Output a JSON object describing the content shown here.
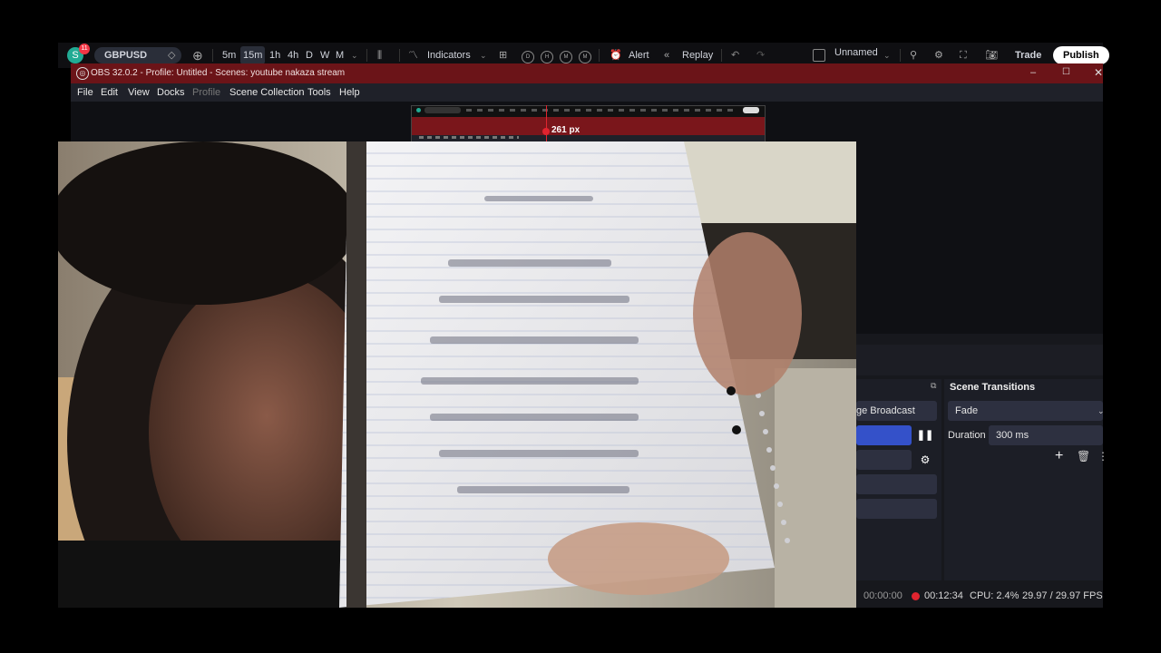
{
  "tradingview": {
    "avatar_letter": "S",
    "notification_count": "11",
    "symbol": "GBPUSD",
    "timeframes": [
      "5m",
      "15m",
      "1h",
      "4h",
      "D",
      "W",
      "M"
    ],
    "indicators_label": "Indicators",
    "layout_buttons": [
      "D",
      "H",
      "M",
      "M"
    ],
    "alert_label": "Alert",
    "replay_label": "Replay",
    "layout_name": "Unnamed",
    "trade_label": "Trade",
    "publish_label": "Publish"
  },
  "obs": {
    "window_title": "OBS 32.0.2 - Profile: Untitled - Scenes: youtube nakaza stream",
    "menu": [
      "File",
      "Edit",
      "View",
      "Docks",
      "Profile",
      "Scene Collection",
      "Tools",
      "Help"
    ],
    "measure_label": "261 px",
    "controls": {
      "broadcast_label": "ge Broadcast"
    },
    "transitions": {
      "title": "Scene Transitions",
      "selected": "Fade",
      "duration_label": "Duration",
      "duration_value": "300 ms"
    },
    "status": {
      "stream_time": "00:00:00",
      "record_time": "00:12:34",
      "cpu": "CPU: 2.4%",
      "fps": "29.97 / 29.97 FPS"
    }
  },
  "colors": {
    "title_bar": "#6b1418",
    "accent_blue": "#3451c9",
    "record_red": "#e0242f",
    "tv_green": "#22ab94"
  }
}
